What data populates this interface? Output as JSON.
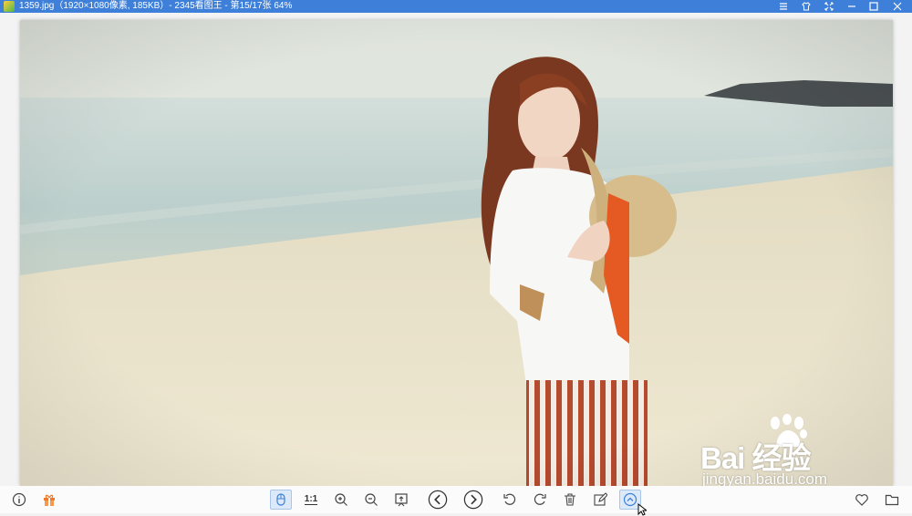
{
  "window": {
    "title": "1359.jpg（1920×1080像素, 185KB）- 2345看图王 - 第15/17张 64%",
    "controls": [
      "menu-icon",
      "skin-icon",
      "fullscreen-icon",
      "minimize-icon",
      "maximize-icon",
      "close-icon"
    ]
  },
  "photo": {
    "description_icon": "beach-photo",
    "colors": {
      "sky": "#e6ebe3",
      "sea": "#b9cdcb",
      "sand": "#ece6cf"
    }
  },
  "watermark": {
    "brand": "Bai  经验",
    "url": "jingyan.baidu.com"
  },
  "toolbar": {
    "ratio_label": "1:1",
    "left_icons": [
      "info-icon",
      "gift-icon"
    ],
    "center_icons": [
      "mouse-mode-icon",
      "actual-size-icon",
      "zoom-in-icon",
      "zoom-out-icon",
      "fit-window-icon",
      "previous-icon",
      "next-icon",
      "rotate-left-icon",
      "rotate-right-icon",
      "delete-icon",
      "edit-icon",
      "more-icon"
    ],
    "right_icons": [
      "favorite-icon",
      "folder-icon"
    ],
    "accent": "#3d7fd9"
  }
}
